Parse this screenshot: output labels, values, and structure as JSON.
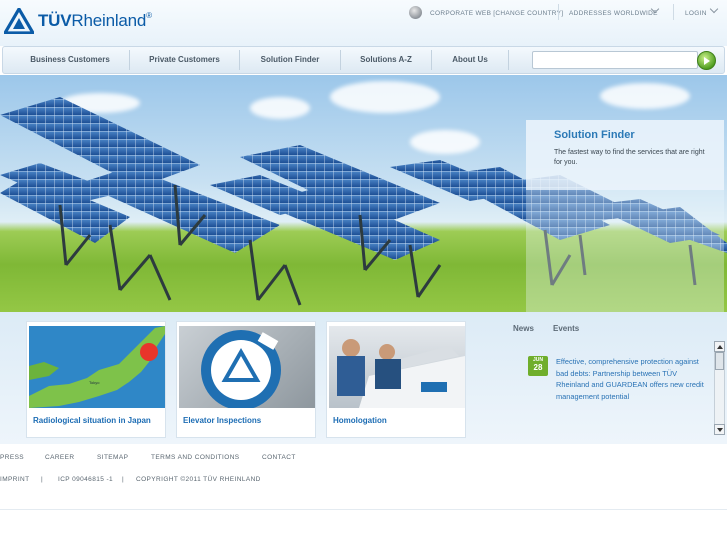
{
  "brand": {
    "name_bold": "TÜV",
    "name_rest": "Rheinland",
    "registered": "®"
  },
  "utility": {
    "corporate_web": "CORPORATE WEB [CHANGE COUNTRY]",
    "addresses": "ADDRESSES WORLDWIDE",
    "login": "LOGIN"
  },
  "nav": {
    "items": [
      "Business Customers",
      "Private Customers",
      "Solution Finder",
      "Solutions A-Z",
      "About Us"
    ],
    "search_value": ""
  },
  "hero": {
    "promo_title": "Solution Finder",
    "promo_text": "The fastest way to find the services that are right for you."
  },
  "teasers": [
    {
      "label": "Radiological situation in Japan"
    },
    {
      "label": "Elevator Inspections"
    },
    {
      "label": "Homologation"
    }
  ],
  "news": {
    "tabs": [
      "News",
      "Events"
    ],
    "item": {
      "month": "JUN",
      "day": "28",
      "text": "Effective, comprehensive protection against bad debts: Partnership between TÜV Rheinland and GUARDEAN offers new credit management potential"
    }
  },
  "footer": {
    "row1": [
      "PRESS",
      "CAREER",
      "SITEMAP",
      "TERMS AND CONDITIONS",
      "CONTACT"
    ],
    "row2": [
      "IMPRINT",
      "|",
      "ICP 09046815 -1",
      "|",
      "COPYRIGHT ©2011 TÜV RHEINLAND"
    ]
  },
  "colors": {
    "brand_blue": "#0b5ba7",
    "link_blue": "#1d6db4",
    "accent_green": "#6fae2b"
  },
  "icons": [
    "logo-triangle-icon",
    "globe-icon",
    "chevron-down-icon",
    "search-go-icon",
    "scroll-up-icon",
    "scroll-down-icon"
  ]
}
